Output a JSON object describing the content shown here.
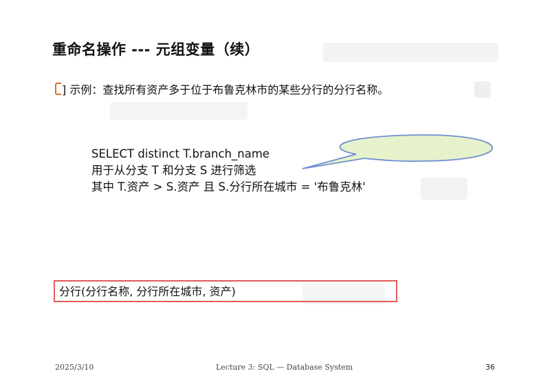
{
  "slide": {
    "title": "重命名操作 --- 元组变量（续）",
    "bullet": {
      "marker": "]",
      "text": "示例：查找所有资产多于位于布鲁克林市的某些分行的分行名称。"
    },
    "query_lines": [
      "SELECT distinct T.branch_name",
      "用于从分支 T 和分支 S 进行筛选",
      "其中 T.资产 > S.资产 且 S.分行所在城市 = '布鲁克林'"
    ],
    "schema": "分行(分行名称, 分行所在城市, 资产)"
  },
  "footer": {
    "date": "2025/3/10",
    "lecture": "Lecture 3: SQL — Database System",
    "page_number": "36"
  },
  "colors": {
    "callout_fill": "#e6f2cc",
    "callout_stroke": "#6f8fce",
    "bullet_marker": "#e26a1f",
    "schema_border": "#e05a57"
  }
}
